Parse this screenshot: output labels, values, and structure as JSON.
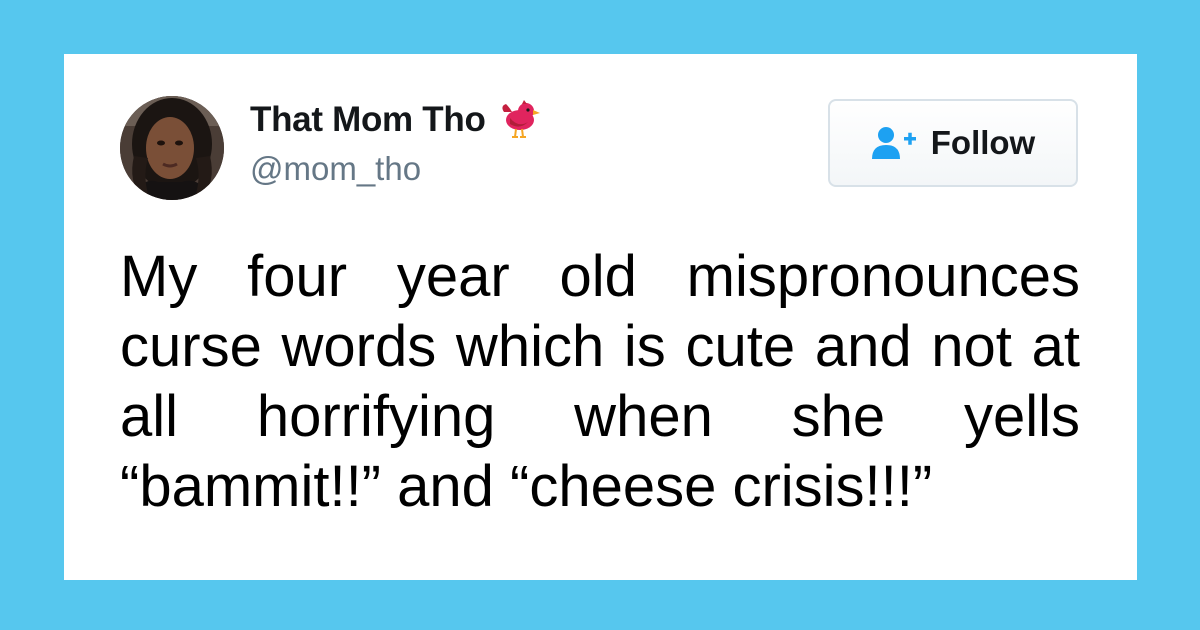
{
  "colors": {
    "background": "#56c7ee",
    "card": "#ffffff",
    "name": "#14171a",
    "handle": "#657786",
    "follow_icon": "#1da1f2",
    "bird_emoji": "#e0245e"
  },
  "tweet": {
    "author": {
      "display_name": "That Mom Tho",
      "handle": "@mom_tho",
      "avatar": "profile-photo",
      "name_emoji": "red-bird-icon"
    },
    "follow_button": {
      "label": "Follow",
      "icon": "add-user-icon"
    },
    "text": "My four year old mispronounces curse words which is cute and not at all horrifying when she yells “bammit!!” and “cheese crisis!!!”"
  }
}
